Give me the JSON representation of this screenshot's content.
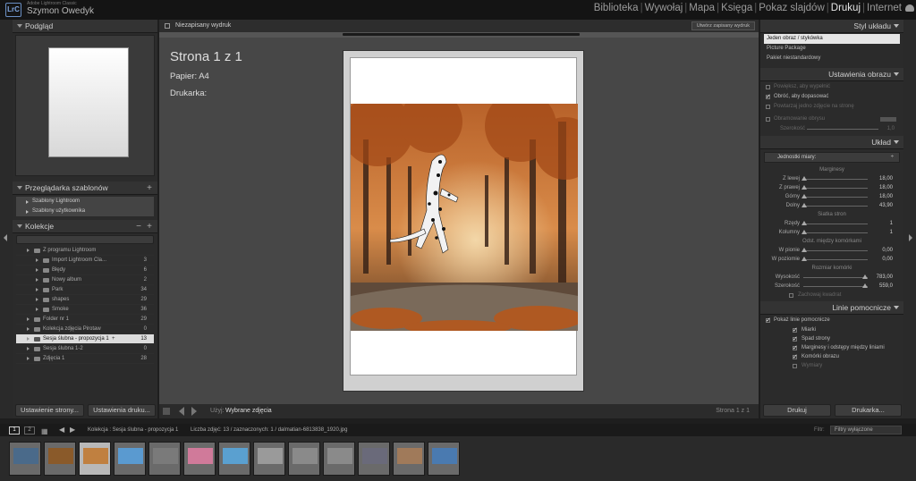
{
  "app": {
    "brand": "Adobe Lightroom Classic",
    "user": "Szymon Owedyk",
    "logo": "LrC",
    "modules": [
      "Biblioteka",
      "Wywołaj",
      "Mapa",
      "Księga",
      "Pokaz slajdów",
      "Drukuj",
      "Internet"
    ],
    "active_module": "Drukuj"
  },
  "left": {
    "preview_title": "Podgląd",
    "templates_title": "Przeglądarka szablonów",
    "templates": [
      "Szablony Lightroom",
      "Szablony użytkownika"
    ],
    "collections_title": "Kolekcje",
    "collections": [
      {
        "name": "Z programu Lightroom",
        "count": "",
        "indent": 1
      },
      {
        "name": "Import Lightroom Cla...",
        "count": "3",
        "indent": 2
      },
      {
        "name": "Błędy",
        "count": "6",
        "indent": 2
      },
      {
        "name": "Nowy album",
        "count": "2",
        "indent": 2
      },
      {
        "name": "Park",
        "count": "34",
        "indent": 2
      },
      {
        "name": "shapes",
        "count": "29",
        "indent": 2
      },
      {
        "name": "Smoke",
        "count": "36",
        "indent": 2
      },
      {
        "name": "Folder nr 1",
        "count": "29",
        "indent": 1
      },
      {
        "name": "Kolekcja zdjęcia Pirotaw",
        "count": "0",
        "indent": 1
      },
      {
        "name": "Sesja ślubna - propozycja 1",
        "count": "13",
        "indent": 1,
        "selected": true
      },
      {
        "name": "Sesja ślubna 1-2",
        "count": "0",
        "indent": 1
      },
      {
        "name": "Zdjęcia 1",
        "count": "28",
        "indent": 1
      }
    ],
    "page_setup_btn": "Ustawienie strony...",
    "print_settings_btn": "Ustawienia druku..."
  },
  "center": {
    "doc_name": "Niezapisany wydruk",
    "save_btn": "Utwórz zapisany wydruk",
    "page_label": "Strona 1 z 1",
    "paper": "Papier: A4",
    "printer": "Drukarka:",
    "style_label": "Użyj:",
    "style_value": "Wybrane zdjęcia",
    "page_count": "Strona 1 z 1"
  },
  "right": {
    "layout_style_title": "Styl układu",
    "layout_styles": [
      "Jeden obraz / stykówka",
      "Picture Package",
      "Pakiet niestandardowy"
    ],
    "image_settings_title": "Ustawienia obrazu",
    "image_settings": [
      {
        "label": "Powiększ, aby wypełnić",
        "on": false
      },
      {
        "label": "Obróć, aby dopasować",
        "on": true
      },
      {
        "label": "Powtarzaj jedno zdjęcie na stronę",
        "on": false
      }
    ],
    "stroke_label": "Obramowanie obrysu",
    "stroke_width_label": "Szerokość",
    "stroke_width_value": "1,0",
    "layout_title": "Układ",
    "units": "Jednostki miary:",
    "margins_head": "Marginesy",
    "margins": [
      {
        "label": "Z lewej",
        "value": "18,00",
        "v": 0.0
      },
      {
        "label": "Z prawej",
        "value": "18,00",
        "v": 0.0
      },
      {
        "label": "Górny",
        "value": "18,00",
        "v": 0.0
      },
      {
        "label": "Dolny",
        "value": "43,90",
        "v": 0.0
      }
    ],
    "grid_head": "Siatka stron",
    "grid": [
      {
        "label": "Rzędy",
        "value": "1"
      },
      {
        "label": "Kolumny",
        "value": "1"
      }
    ],
    "spacing_head": "Odst. między komórkami",
    "spacing": [
      {
        "label": "W pionie",
        "value": "0,00"
      },
      {
        "label": "W poziomie",
        "value": "0,00"
      }
    ],
    "cell_head": "Rozmiar komórki",
    "cell": [
      {
        "label": "Wysokość",
        "value": "783,00"
      },
      {
        "label": "Szerokość",
        "value": "559,0"
      }
    ],
    "keep_square": "Zachowaj kwadrat",
    "guides_title": "Linie pomocnicze",
    "show_guides": "Pokaż linie pomocnicze",
    "guides": [
      "Miarki",
      "Spad strony",
      "Marginesy i odstępy między liniami",
      "Komórki obrazu",
      "Wymiary"
    ],
    "print_btn": "Drukuj",
    "printer_btn": "Drukarka..."
  },
  "filmstrip": {
    "pages": [
      "1",
      "2"
    ],
    "path": "Kolekcja : Sesja ślubna - propozycja 1",
    "info": "Liczba zdjęć: 13 / zaznaczonych: 1 / dalmatian-6813838_1920.jpg",
    "filter_label": "Filtr:",
    "filter_value": "Filtry wyłączone",
    "thumbs": 13
  }
}
